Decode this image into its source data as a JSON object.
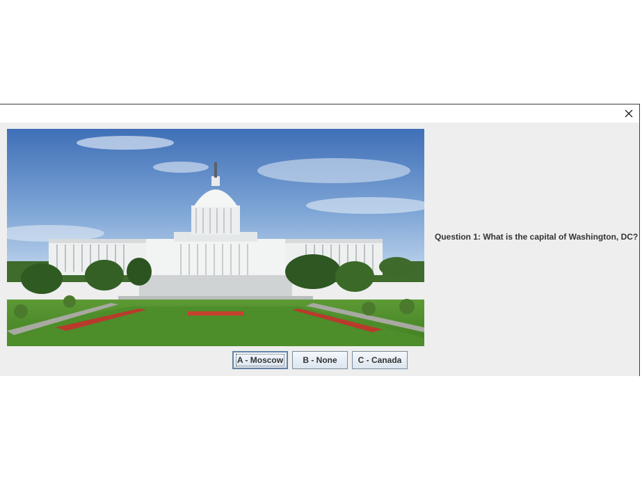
{
  "question": {
    "text": "Question 1: What is the capital of Washington, DC?"
  },
  "answers": [
    {
      "label": "A - Moscow",
      "focused": true
    },
    {
      "label": "B - None",
      "focused": false
    },
    {
      "label": "C - Canada",
      "focused": false
    }
  ],
  "window": {
    "close_icon": "close-icon"
  },
  "image": {
    "subject": "us-capitol-building-photo"
  }
}
